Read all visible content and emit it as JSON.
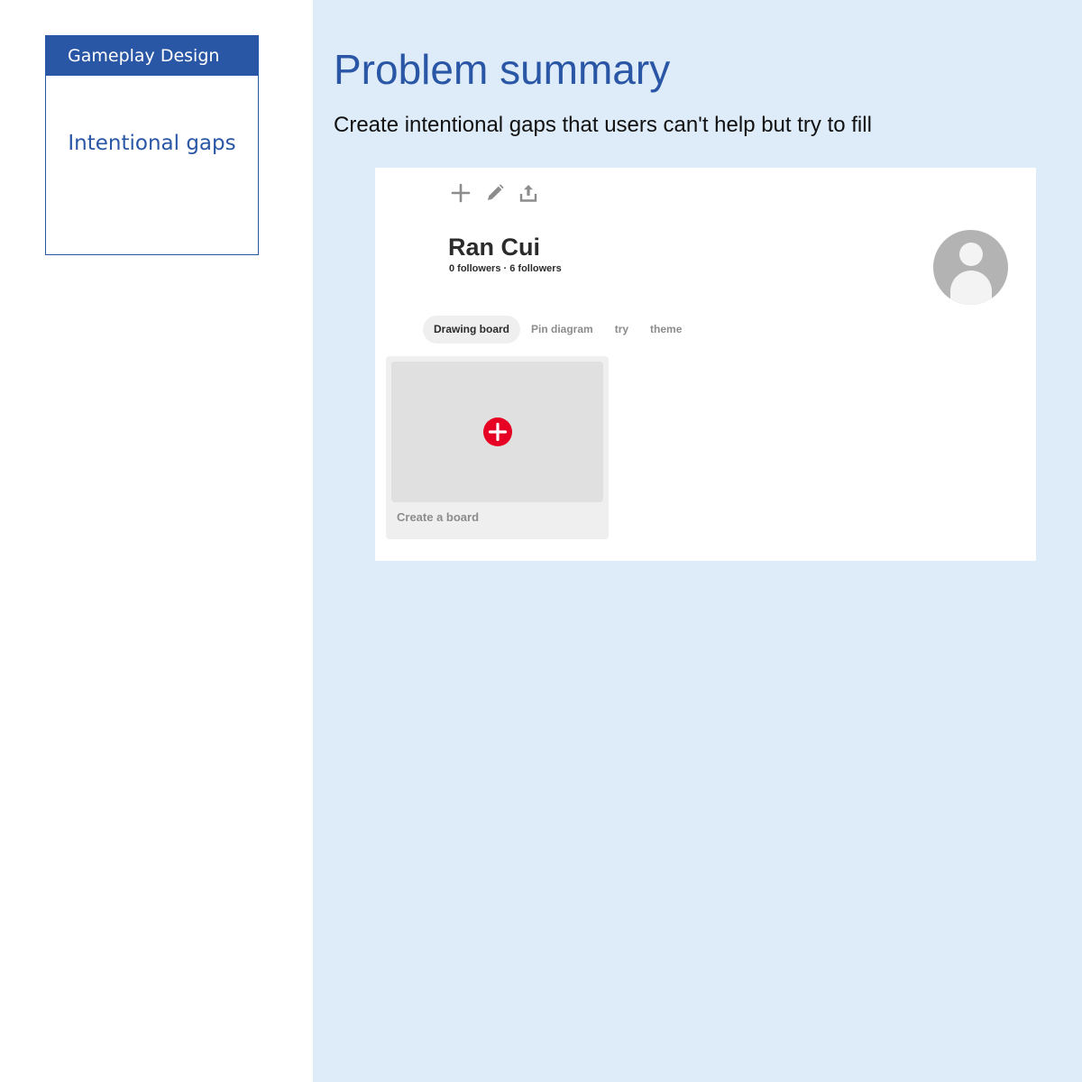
{
  "sidebar": {
    "category": "Gameplay Design",
    "topic": "Intentional gaps"
  },
  "main": {
    "title": "Problem summary",
    "subtitle": "Create intentional gaps that users can't help but try to fill"
  },
  "mockup": {
    "toolbar": [
      "plus-icon",
      "pencil-icon",
      "share-icon"
    ],
    "profile": {
      "name": "Ran Cui",
      "stats": "0 followers · 6 followers"
    },
    "tabs": [
      {
        "label": "Drawing board",
        "active": true
      },
      {
        "label": "Pin diagram",
        "active": false
      },
      {
        "label": "try",
        "active": false
      },
      {
        "label": "theme",
        "active": false
      }
    ],
    "board": {
      "label": "Create a board"
    }
  },
  "colors": {
    "accent": "#2a56a6",
    "panel_background": "#deebf8",
    "add_badge": "#e60023",
    "icon_gray": "#8c8c8c"
  }
}
